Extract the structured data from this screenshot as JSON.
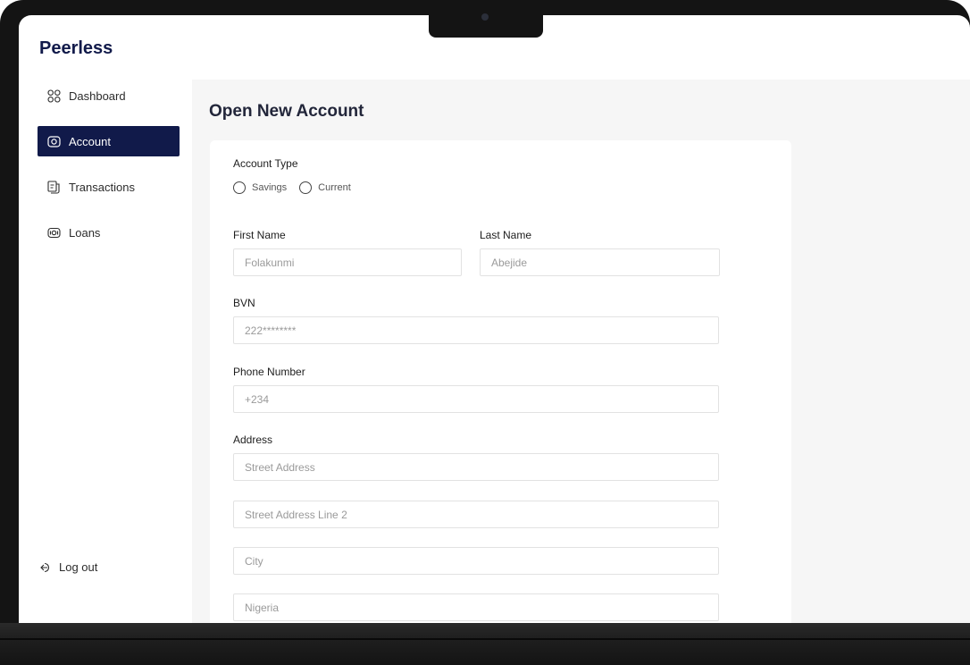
{
  "app": {
    "brand": "Peerless"
  },
  "sidebar": {
    "items": [
      {
        "label": "Dashboard",
        "icon": "dashboard-grid-icon",
        "active": false
      },
      {
        "label": "Account",
        "icon": "account-icon",
        "active": true
      },
      {
        "label": "Transactions",
        "icon": "transactions-icon",
        "active": false
      },
      {
        "label": "Loans",
        "icon": "loans-icon",
        "active": false
      }
    ],
    "logout_label": "Log out"
  },
  "main": {
    "title": "Open New Account",
    "form": {
      "account_type": {
        "label": "Account Type",
        "options": [
          "Savings",
          "Current"
        ]
      },
      "first_name": {
        "label": "First Name",
        "placeholder": "Folakunmi"
      },
      "last_name": {
        "label": "Last Name",
        "placeholder": "Abejide"
      },
      "bvn": {
        "label": "BVN",
        "placeholder": "222********"
      },
      "phone": {
        "label": "Phone Number",
        "placeholder": "+234"
      },
      "address": {
        "label": "Address",
        "street": "Street Address",
        "street2": "Street Address Line 2",
        "city": "City",
        "country": "Nigeria"
      }
    }
  },
  "colors": {
    "accent": "#111a4a",
    "background": "#f6f6f6"
  }
}
